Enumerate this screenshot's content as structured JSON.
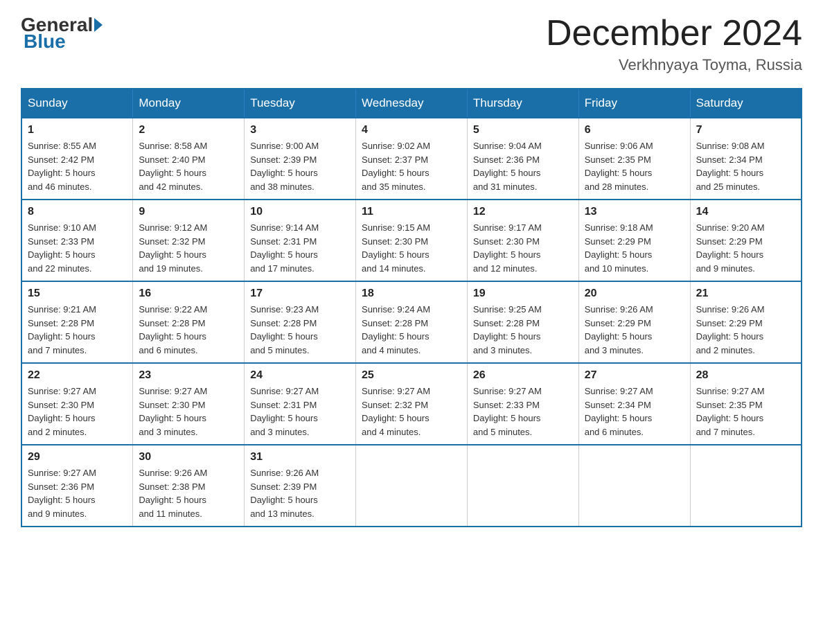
{
  "header": {
    "logo_general": "General",
    "logo_blue": "Blue",
    "month_title": "December 2024",
    "subtitle": "Verkhnyaya Toyma, Russia"
  },
  "weekdays": [
    "Sunday",
    "Monday",
    "Tuesday",
    "Wednesday",
    "Thursday",
    "Friday",
    "Saturday"
  ],
  "weeks": [
    [
      {
        "day": "1",
        "info": "Sunrise: 8:55 AM\nSunset: 2:42 PM\nDaylight: 5 hours\nand 46 minutes."
      },
      {
        "day": "2",
        "info": "Sunrise: 8:58 AM\nSunset: 2:40 PM\nDaylight: 5 hours\nand 42 minutes."
      },
      {
        "day": "3",
        "info": "Sunrise: 9:00 AM\nSunset: 2:39 PM\nDaylight: 5 hours\nand 38 minutes."
      },
      {
        "day": "4",
        "info": "Sunrise: 9:02 AM\nSunset: 2:37 PM\nDaylight: 5 hours\nand 35 minutes."
      },
      {
        "day": "5",
        "info": "Sunrise: 9:04 AM\nSunset: 2:36 PM\nDaylight: 5 hours\nand 31 minutes."
      },
      {
        "day": "6",
        "info": "Sunrise: 9:06 AM\nSunset: 2:35 PM\nDaylight: 5 hours\nand 28 minutes."
      },
      {
        "day": "7",
        "info": "Sunrise: 9:08 AM\nSunset: 2:34 PM\nDaylight: 5 hours\nand 25 minutes."
      }
    ],
    [
      {
        "day": "8",
        "info": "Sunrise: 9:10 AM\nSunset: 2:33 PM\nDaylight: 5 hours\nand 22 minutes."
      },
      {
        "day": "9",
        "info": "Sunrise: 9:12 AM\nSunset: 2:32 PM\nDaylight: 5 hours\nand 19 minutes."
      },
      {
        "day": "10",
        "info": "Sunrise: 9:14 AM\nSunset: 2:31 PM\nDaylight: 5 hours\nand 17 minutes."
      },
      {
        "day": "11",
        "info": "Sunrise: 9:15 AM\nSunset: 2:30 PM\nDaylight: 5 hours\nand 14 minutes."
      },
      {
        "day": "12",
        "info": "Sunrise: 9:17 AM\nSunset: 2:30 PM\nDaylight: 5 hours\nand 12 minutes."
      },
      {
        "day": "13",
        "info": "Sunrise: 9:18 AM\nSunset: 2:29 PM\nDaylight: 5 hours\nand 10 minutes."
      },
      {
        "day": "14",
        "info": "Sunrise: 9:20 AM\nSunset: 2:29 PM\nDaylight: 5 hours\nand 9 minutes."
      }
    ],
    [
      {
        "day": "15",
        "info": "Sunrise: 9:21 AM\nSunset: 2:28 PM\nDaylight: 5 hours\nand 7 minutes."
      },
      {
        "day": "16",
        "info": "Sunrise: 9:22 AM\nSunset: 2:28 PM\nDaylight: 5 hours\nand 6 minutes."
      },
      {
        "day": "17",
        "info": "Sunrise: 9:23 AM\nSunset: 2:28 PM\nDaylight: 5 hours\nand 5 minutes."
      },
      {
        "day": "18",
        "info": "Sunrise: 9:24 AM\nSunset: 2:28 PM\nDaylight: 5 hours\nand 4 minutes."
      },
      {
        "day": "19",
        "info": "Sunrise: 9:25 AM\nSunset: 2:28 PM\nDaylight: 5 hours\nand 3 minutes."
      },
      {
        "day": "20",
        "info": "Sunrise: 9:26 AM\nSunset: 2:29 PM\nDaylight: 5 hours\nand 3 minutes."
      },
      {
        "day": "21",
        "info": "Sunrise: 9:26 AM\nSunset: 2:29 PM\nDaylight: 5 hours\nand 2 minutes."
      }
    ],
    [
      {
        "day": "22",
        "info": "Sunrise: 9:27 AM\nSunset: 2:30 PM\nDaylight: 5 hours\nand 2 minutes."
      },
      {
        "day": "23",
        "info": "Sunrise: 9:27 AM\nSunset: 2:30 PM\nDaylight: 5 hours\nand 3 minutes."
      },
      {
        "day": "24",
        "info": "Sunrise: 9:27 AM\nSunset: 2:31 PM\nDaylight: 5 hours\nand 3 minutes."
      },
      {
        "day": "25",
        "info": "Sunrise: 9:27 AM\nSunset: 2:32 PM\nDaylight: 5 hours\nand 4 minutes."
      },
      {
        "day": "26",
        "info": "Sunrise: 9:27 AM\nSunset: 2:33 PM\nDaylight: 5 hours\nand 5 minutes."
      },
      {
        "day": "27",
        "info": "Sunrise: 9:27 AM\nSunset: 2:34 PM\nDaylight: 5 hours\nand 6 minutes."
      },
      {
        "day": "28",
        "info": "Sunrise: 9:27 AM\nSunset: 2:35 PM\nDaylight: 5 hours\nand 7 minutes."
      }
    ],
    [
      {
        "day": "29",
        "info": "Sunrise: 9:27 AM\nSunset: 2:36 PM\nDaylight: 5 hours\nand 9 minutes."
      },
      {
        "day": "30",
        "info": "Sunrise: 9:26 AM\nSunset: 2:38 PM\nDaylight: 5 hours\nand 11 minutes."
      },
      {
        "day": "31",
        "info": "Sunrise: 9:26 AM\nSunset: 2:39 PM\nDaylight: 5 hours\nand 13 minutes."
      },
      null,
      null,
      null,
      null
    ]
  ]
}
